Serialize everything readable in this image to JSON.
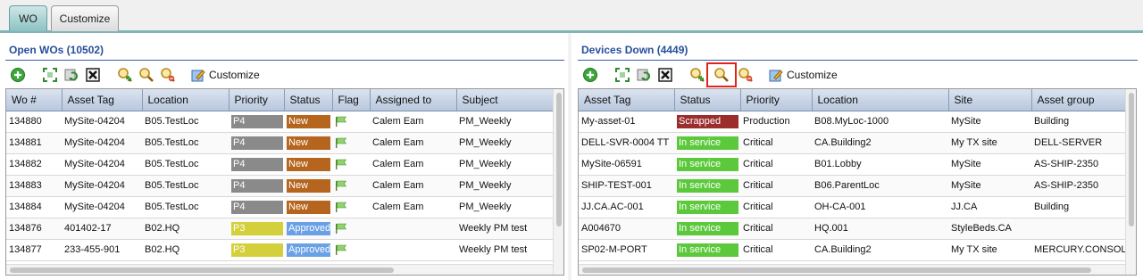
{
  "tabs": [
    "WO",
    "Customize"
  ],
  "left": {
    "title": "Open WOs (10502)",
    "toolbar_customize": "Customize",
    "columns": [
      "Wo #",
      "Asset Tag",
      "Location",
      "Priority",
      "Status",
      "Flag",
      "Assigned to",
      "Subject"
    ],
    "rows": [
      [
        "134880",
        "MySite-04204",
        "B05.TestLoc",
        "P4",
        "New",
        "",
        "Calem Eam",
        "PM_Weekly"
      ],
      [
        "134881",
        "MySite-04204",
        "B05.TestLoc",
        "P4",
        "New",
        "",
        "Calem Eam",
        "PM_Weekly"
      ],
      [
        "134882",
        "MySite-04204",
        "B05.TestLoc",
        "P4",
        "New",
        "",
        "Calem Eam",
        "PM_Weekly"
      ],
      [
        "134883",
        "MySite-04204",
        "B05.TestLoc",
        "P4",
        "New",
        "",
        "Calem Eam",
        "PM_Weekly"
      ],
      [
        "134884",
        "MySite-04204",
        "B05.TestLoc",
        "P4",
        "New",
        "",
        "Calem Eam",
        "PM_Weekly"
      ],
      [
        "134876",
        "401402-17",
        "B02.HQ",
        "P3",
        "Approved",
        "",
        "",
        "Weekly PM test"
      ],
      [
        "134877",
        "233-455-901",
        "B02.HQ",
        "P3",
        "Approved",
        "",
        "",
        "Weekly PM test"
      ]
    ],
    "priority_colors": {
      "P4": "#8a8a8a",
      "P3": "#d4d03c"
    },
    "status_colors": {
      "New": "#b5651d",
      "Approved": "#6aa0e6"
    }
  },
  "right": {
    "title": "Devices Down (4449)",
    "toolbar_customize": "Customize",
    "columns": [
      "Asset Tag",
      "Status",
      "Priority",
      "Location",
      "Site",
      "Asset group"
    ],
    "rows": [
      [
        "My-asset-01",
        "Scrapped",
        "Production",
        "B08.MyLoc-1000",
        "MySite",
        "Building"
      ],
      [
        "DELL-SVR-0004 TT",
        "In service",
        "Critical",
        "CA.Building2",
        "My TX site",
        "DELL-SERVER"
      ],
      [
        "MySite-06591",
        "In service",
        "Critical",
        "B01.Lobby",
        "MySite",
        "AS-SHIP-2350"
      ],
      [
        "SHIP-TEST-001",
        "In service",
        "Critical",
        "B06.ParentLoc",
        "MySite",
        "AS-SHIP-2350"
      ],
      [
        "JJ.CA.AC-001",
        "In service",
        "Critical",
        "OH-CA-001",
        "JJ.CA",
        "Building"
      ],
      [
        "A004670",
        "In service",
        "Critical",
        "HQ.001",
        "StyleBeds.CA",
        ""
      ],
      [
        "SP02-M-PORT",
        "In service",
        "Critical",
        "CA.Building2",
        "My TX site",
        "MERCURY.CONSOL..."
      ]
    ],
    "status_colors": {
      "Scrapped": "#9b2d2d",
      "In service": "#5cc93c"
    }
  },
  "icons": [
    "add-icon",
    "expand-icon",
    "refresh-icon",
    "delete-icon",
    "search-icon",
    "search-clear-icon",
    "search-remove-icon",
    "customize-icon",
    "flag-icon"
  ]
}
